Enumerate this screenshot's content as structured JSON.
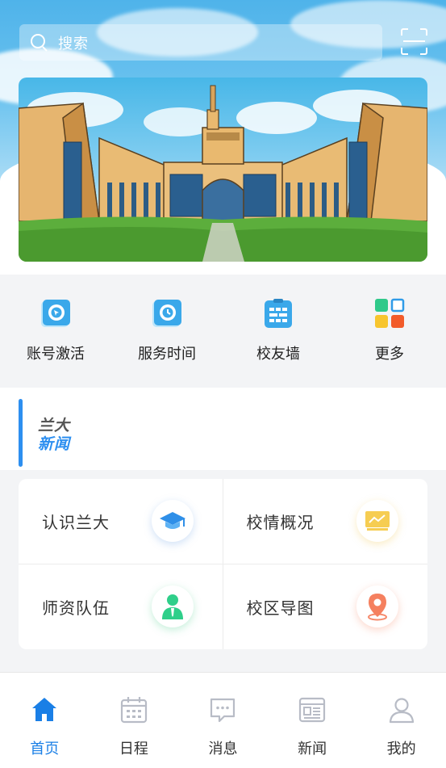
{
  "search": {
    "placeholder": "搜索"
  },
  "quick_actions": [
    {
      "label": "账号激活",
      "icon": "account-activate-icon"
    },
    {
      "label": "服务时间",
      "icon": "clock-icon"
    },
    {
      "label": "校友墙",
      "icon": "wall-icon"
    },
    {
      "label": "更多",
      "icon": "more-grid-icon"
    }
  ],
  "news_section": {
    "logo_top": "兰大",
    "logo_bottom": "新闻"
  },
  "cards": [
    {
      "label": "认识兰大",
      "icon": "graduation-cap-icon"
    },
    {
      "label": "校情概况",
      "icon": "chart-board-icon"
    },
    {
      "label": "师资队伍",
      "icon": "teacher-icon"
    },
    {
      "label": "校区导图",
      "icon": "map-pin-icon"
    }
  ],
  "tabs": [
    {
      "label": "首页",
      "icon": "home-icon",
      "active": true
    },
    {
      "label": "日程",
      "icon": "calendar-icon",
      "active": false
    },
    {
      "label": "消息",
      "icon": "message-icon",
      "active": false
    },
    {
      "label": "新闻",
      "icon": "news-icon",
      "active": false
    },
    {
      "label": "我的",
      "icon": "user-icon",
      "active": false
    }
  ],
  "colors": {
    "accent": "#1a7fe6",
    "inactive": "#b8bcc6"
  }
}
